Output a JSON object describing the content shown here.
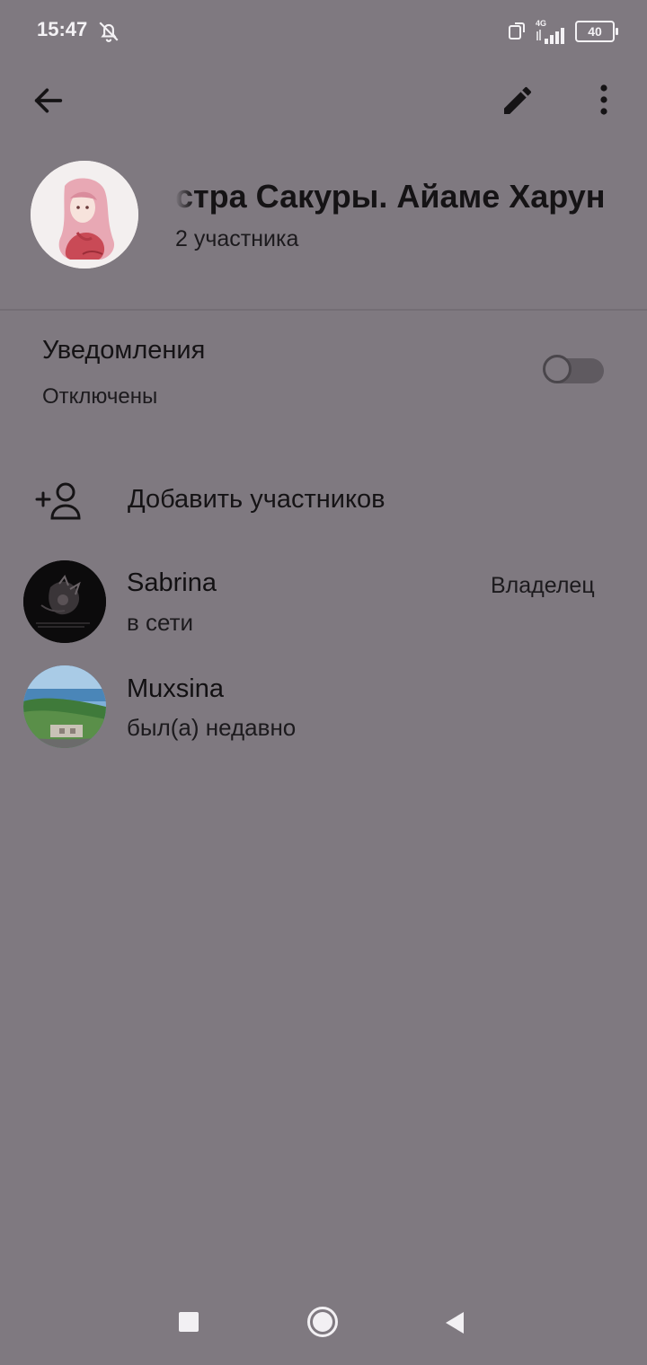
{
  "status_bar": {
    "time": "15:47",
    "network": "4G",
    "battery": "40"
  },
  "icons": {
    "back": "arrow-left",
    "edit": "pencil",
    "more": "more-vertical",
    "bell_off": "bell-off",
    "add_member": "person-add"
  },
  "group": {
    "title": "стра Сакуры. Айаме Харун",
    "subtitle": "2 участника"
  },
  "notifications": {
    "title": "Уведомления",
    "status": "Отключены",
    "enabled": false
  },
  "add_members": {
    "label": "Добавить участников"
  },
  "members": [
    {
      "name": "Sabrina",
      "status": "в сети",
      "role": "Владелец"
    },
    {
      "name": "Muxsina",
      "status": "был(а) недавно",
      "role": ""
    }
  ],
  "colors": {
    "background": "#7f7980",
    "text": "#151315",
    "status_bar_text": "#f4f2f5"
  }
}
